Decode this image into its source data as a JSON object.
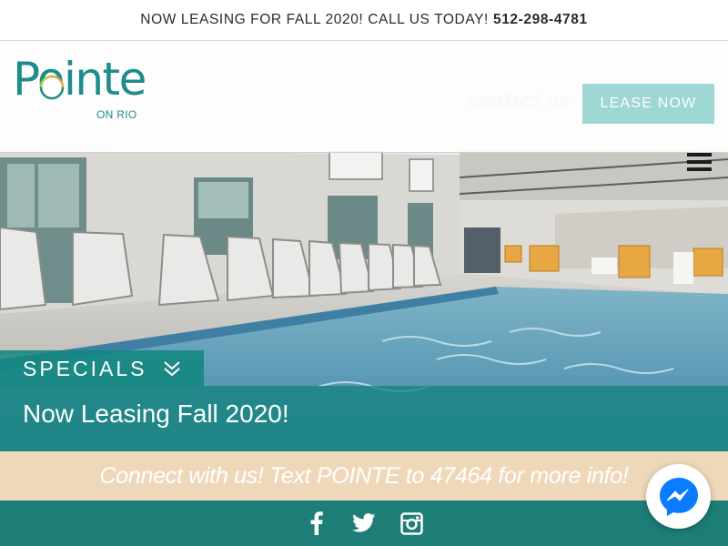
{
  "announcement": {
    "text": "NOW LEASING FOR FALL 2020! CALL US TODAY!",
    "phone": "512-298-4781"
  },
  "header": {
    "logo_name": "Pointe",
    "logo_sub": "ON RIO",
    "contact_label": "CONTACT US",
    "lease_label": "LEASE NOW"
  },
  "specials": {
    "tab_label": "SPECIALS",
    "headline": "Now Leasing Fall 2020!"
  },
  "connect": {
    "text": "Connect with us! Text POINTE to 47464 for more info!"
  },
  "social": {
    "icons": [
      "facebook-icon",
      "twitter-icon",
      "instagram-icon"
    ]
  },
  "colors": {
    "brand_teal": "#1e8c8a",
    "lease_button": "#9ed7d3",
    "specials_bg": "#12867e",
    "connect_bg": "#efd8b9",
    "footer_bg": "#1d7e78",
    "messenger_blue": "#0a7cff"
  }
}
